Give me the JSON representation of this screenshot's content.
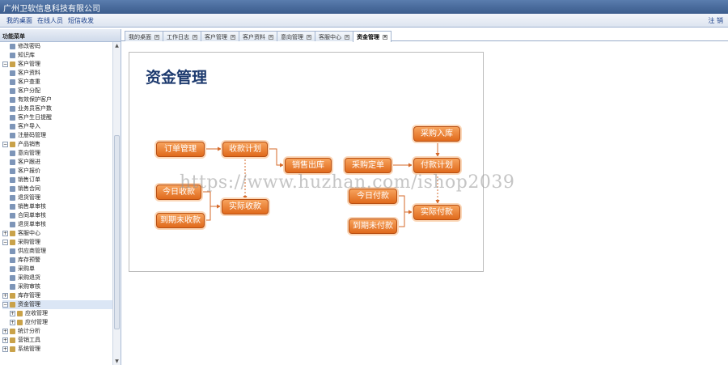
{
  "app": {
    "title": "广州卫软信息科技有限公司"
  },
  "navbar": {
    "links": [
      "我的桌面",
      "在线人员",
      "短信收发"
    ],
    "logout": "注 销"
  },
  "sidebar": {
    "header": "功能菜单",
    "items": [
      {
        "label": "修改密码",
        "level": 2,
        "icon": "edit-icon"
      },
      {
        "label": "知识库",
        "level": 2,
        "icon": "page-icon"
      },
      {
        "label": "客户管理",
        "level": 1,
        "expanded": true
      },
      {
        "label": "客户资料",
        "level": 2,
        "icon": "page-icon"
      },
      {
        "label": "客户查重",
        "level": 2,
        "icon": "page-icon"
      },
      {
        "label": "客户分配",
        "level": 2,
        "icon": "search-icon"
      },
      {
        "label": "有效保护客户",
        "level": 2,
        "icon": "page-icon"
      },
      {
        "label": "业务员客户数",
        "level": 2,
        "icon": "page-icon"
      },
      {
        "label": "客户生日提醒",
        "level": 2,
        "icon": "page-icon"
      },
      {
        "label": "客户导入",
        "level": 2,
        "icon": "page-icon"
      },
      {
        "label": "注册码管理",
        "level": 2,
        "icon": "page-icon"
      },
      {
        "label": "产品销售",
        "level": 1,
        "expanded": true
      },
      {
        "label": "意向管理",
        "level": 2,
        "icon": "page-icon"
      },
      {
        "label": "客户跟进",
        "level": 2,
        "icon": "search-icon"
      },
      {
        "label": "客户报价",
        "level": 2,
        "icon": "page-icon"
      },
      {
        "label": "销售订单",
        "level": 2,
        "icon": "edit-icon"
      },
      {
        "label": "销售合同",
        "level": 2,
        "icon": "dot-icon"
      },
      {
        "label": "退货管理",
        "level": 2,
        "icon": "page-icon"
      },
      {
        "label": "销售单审核",
        "level": 2,
        "icon": "page-icon"
      },
      {
        "label": "合同单审核",
        "level": 2,
        "icon": "page-icon"
      },
      {
        "label": "退货单审核",
        "level": 2,
        "icon": "page-icon"
      },
      {
        "label": "客服中心",
        "level": 1,
        "expanded": false
      },
      {
        "label": "采购管理",
        "level": 1,
        "expanded": true
      },
      {
        "label": "供应商管理",
        "level": 2,
        "icon": "page-icon"
      },
      {
        "label": "库存预警",
        "level": 2,
        "icon": "page-icon"
      },
      {
        "label": "采购单",
        "level": 2,
        "icon": "page-icon"
      },
      {
        "label": "采购退货",
        "level": 2,
        "icon": "page-icon"
      },
      {
        "label": "采购审核",
        "level": 2,
        "icon": "page-icon"
      },
      {
        "label": "库存管理",
        "level": 1,
        "expanded": false
      },
      {
        "label": "资金管理",
        "level": 1,
        "expanded": true,
        "selected": true
      },
      {
        "label": "应收管理",
        "level": 2,
        "expanded": false
      },
      {
        "label": "应付管理",
        "level": 2,
        "expanded": false
      },
      {
        "label": "统计分析",
        "level": 1,
        "expanded": false
      },
      {
        "label": "营销工具",
        "level": 1,
        "expanded": false
      },
      {
        "label": "系统管理",
        "level": 1,
        "expanded": false
      }
    ]
  },
  "tabs": [
    {
      "label": "我的桌面"
    },
    {
      "label": "工作日志"
    },
    {
      "label": "客户管理"
    },
    {
      "label": "客户资料"
    },
    {
      "label": "意向管理"
    },
    {
      "label": "客服中心"
    },
    {
      "label": "资金管理",
      "active": true
    }
  ],
  "content": {
    "heading": "资金管理",
    "flow": {
      "order_mgmt": "订单管理",
      "receipt_plan": "收款计划",
      "sales_out": "销售出库",
      "today_receipt": "今日收款",
      "overdue_receipt": "到期未收款",
      "actual_receipt": "实际收款",
      "purchase_in": "采购入库",
      "purchase_order": "采购定单",
      "payment_plan": "付款计划",
      "today_payment": "今日付款",
      "overdue_payment": "到期未付款",
      "actual_payment": "实际付款"
    }
  },
  "watermark": "https://www.huzhan.com/ishop2039",
  "colors": {
    "accent": "#e06a1c",
    "header": "#3b5c8c",
    "heading": "#1d3a6e"
  }
}
